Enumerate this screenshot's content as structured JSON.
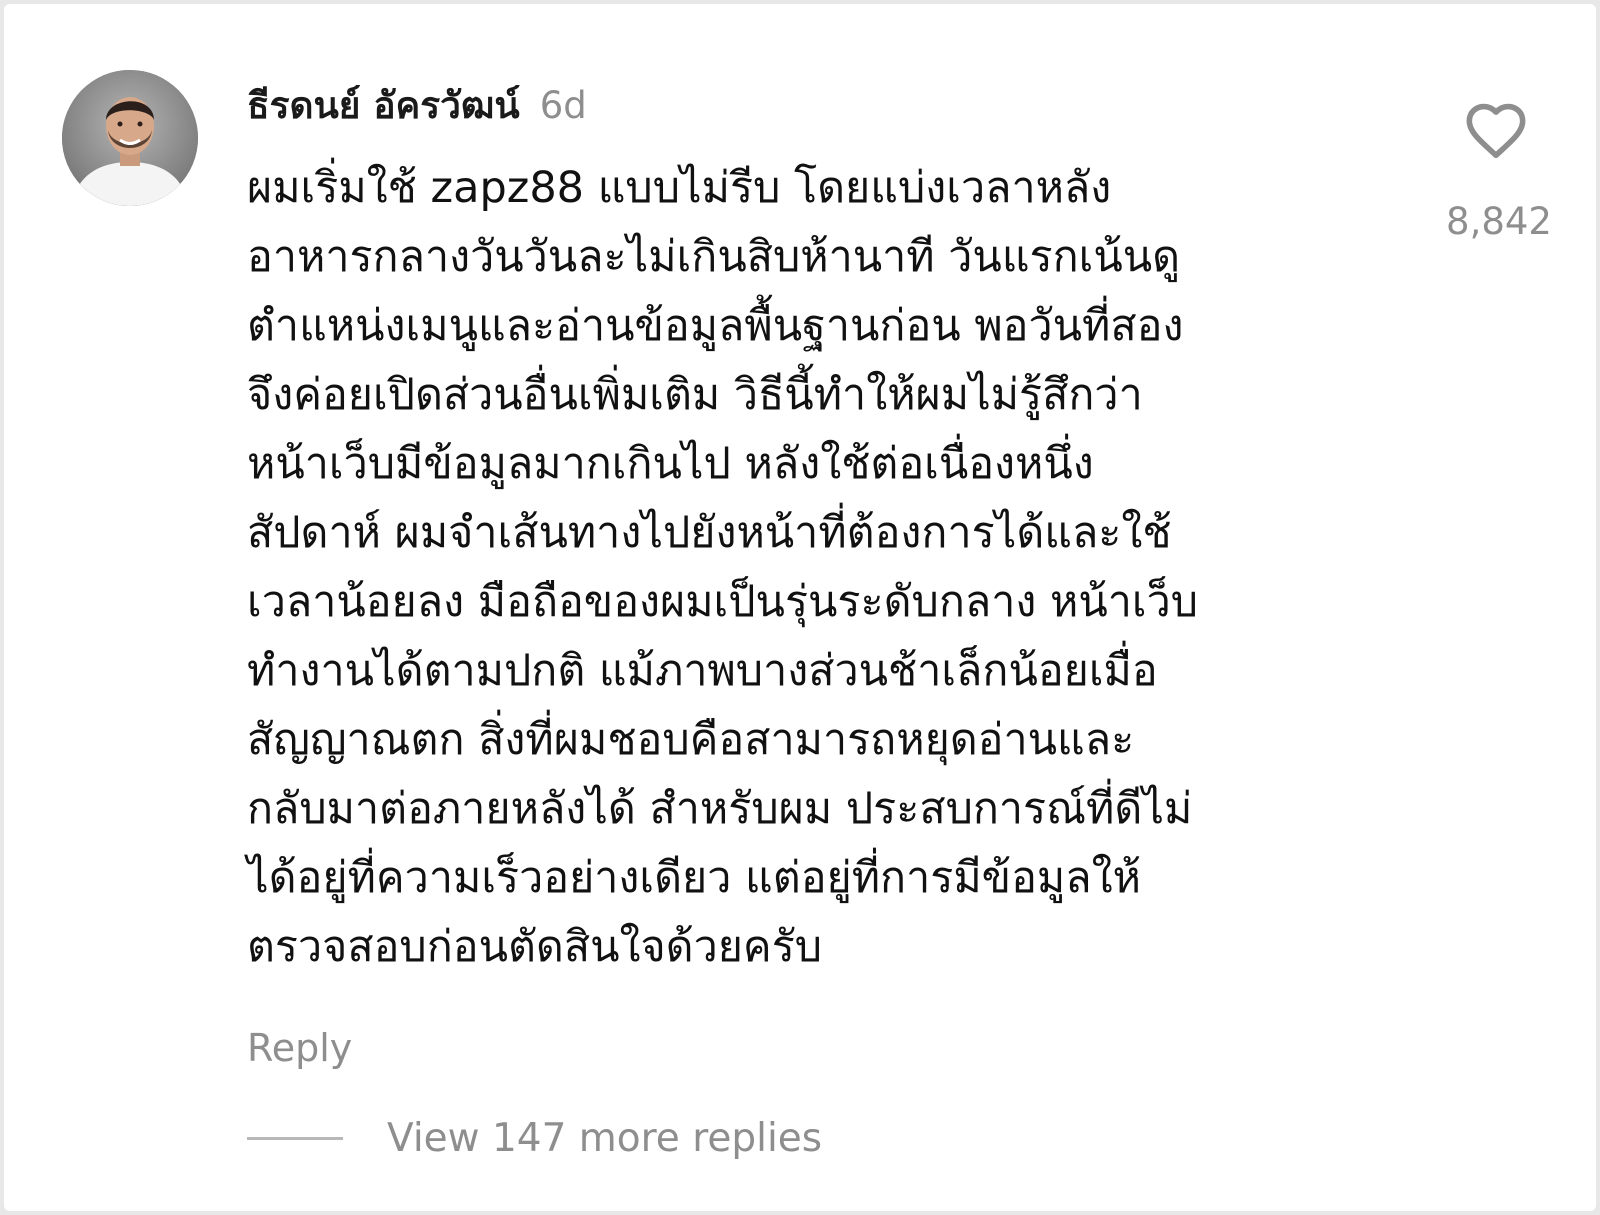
{
  "comment": {
    "username": "ธีรดนย์ อัครวัฒน์",
    "timestamp": "6d",
    "lines": [
      "ผมเริ่มใช้ zapz88 แบบไม่รีบ โดยแบ่งเวลาหลัง",
      "อาหารกลางวันวันละไม่เกินสิบห้านาที วันแรกเน้นดู",
      "ตำแหน่งเมนูและอ่านข้อมูลพื้นฐานก่อน พอวันที่สอง",
      "จึงค่อยเปิดส่วนอื่นเพิ่มเติม วิธีนี้ทำให้ผมไม่รู้สึกว่า",
      "หน้าเว็บมีข้อมูลมากเกินไป หลังใช้ต่อเนื่องหนึ่ง",
      "สัปดาห์ ผมจำเส้นทางไปยังหน้าที่ต้องการได้และใช้",
      "เวลาน้อยลง มือถือของผมเป็นรุ่นระดับกลาง หน้าเว็บ",
      "ทำงานได้ตามปกติ แม้ภาพบางส่วนช้าเล็กน้อยเมื่อ",
      "สัญญาณตก สิ่งที่ผมชอบคือสามารถหยุดอ่านและ",
      "กลับมาต่อภายหลังได้ สำหรับผม ประสบการณ์ที่ดีไม่",
      "ได้อยู่ที่ความเร็วอย่างเดียว แต่อยู่ที่การมีข้อมูลให้",
      "ตรวจสอบก่อนตัดสินใจด้วยครับ"
    ],
    "reply_label": "Reply",
    "like_count": "8,842",
    "view_replies_label": "View 147 more replies"
  },
  "icons": {
    "like": "heart-outline-icon",
    "avatar": "user-avatar"
  },
  "colors": {
    "text_primary": "#111111",
    "text_secondary": "#8e8e8e",
    "background": "#ffffff"
  }
}
